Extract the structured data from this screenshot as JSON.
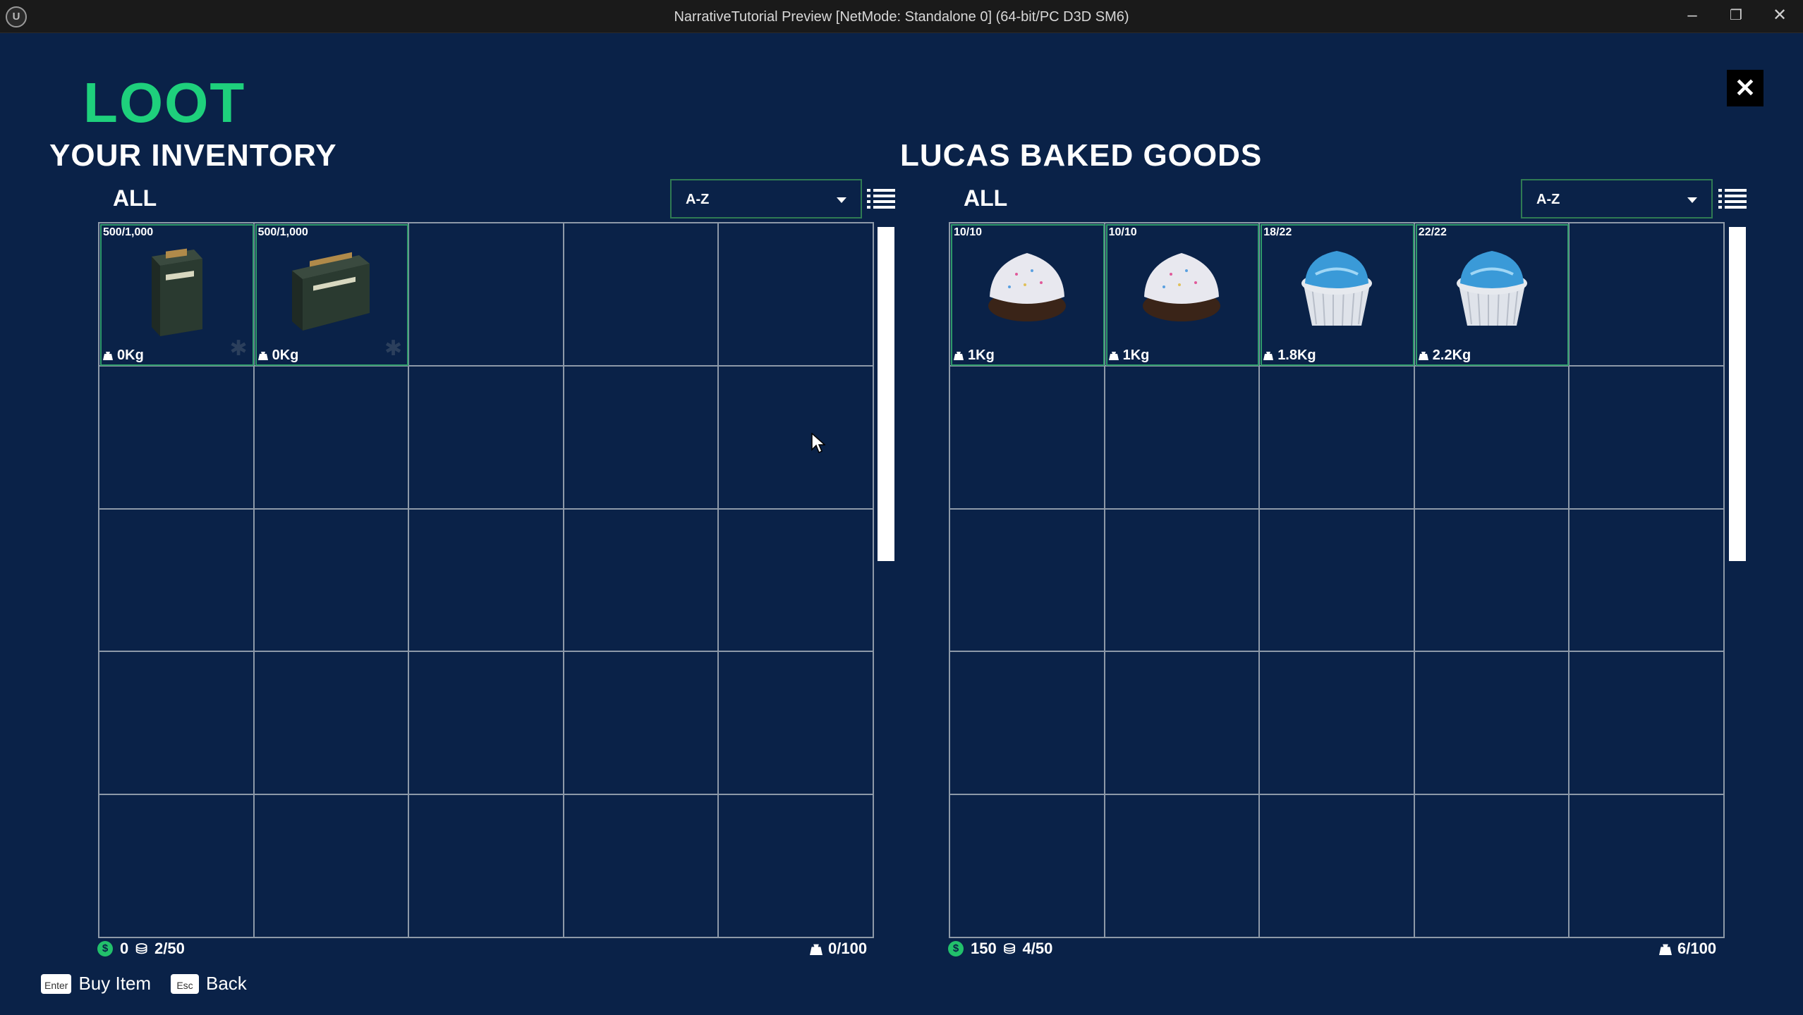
{
  "window": {
    "title": "NarrativeTutorial Preview [NetMode: Standalone 0]  (64-bit/PC D3D SM6)",
    "logo": "U",
    "minimize_glyph": "–",
    "restore_glyph": "❐",
    "close_glyph": "✕"
  },
  "screen": {
    "title": "LOOT",
    "close_glyph": "✕"
  },
  "left_panel": {
    "title": "YOUR INVENTORY",
    "filter": "ALL",
    "sort": "A-Z",
    "items": [
      {
        "qty": "500/1,000",
        "weight": "0Kg",
        "icon": "ammo-box-pistol-icon"
      },
      {
        "qty": "500/1,000",
        "weight": "0Kg",
        "icon": "ammo-box-rifle-icon"
      }
    ],
    "currency": "0",
    "slots": "2/50",
    "weight": "0/100"
  },
  "right_panel": {
    "title": "LUCAS BAKED GOODS",
    "filter": "ALL",
    "sort": "A-Z",
    "items": [
      {
        "qty": "10/10",
        "weight": "1Kg",
        "icon": "chocolate-cupcake-icon"
      },
      {
        "qty": "10/10",
        "weight": "1Kg",
        "icon": "chocolate-cupcake-icon"
      },
      {
        "qty": "18/22",
        "weight": "1.8Kg",
        "icon": "blue-cupcake-icon"
      },
      {
        "qty": "22/22",
        "weight": "2.2Kg",
        "icon": "blue-cupcake-icon"
      }
    ],
    "currency": "150",
    "slots": "4/50",
    "weight": "6/100"
  },
  "hints": {
    "buy_key": "Enter",
    "buy_label": "Buy Item",
    "back_key": "Esc",
    "back_label": "Back"
  },
  "colors": {
    "background": "#0a2248",
    "accent": "#1ed07c",
    "cell_border": "#8d99a8",
    "filled_outline": "#2f9a6b"
  }
}
